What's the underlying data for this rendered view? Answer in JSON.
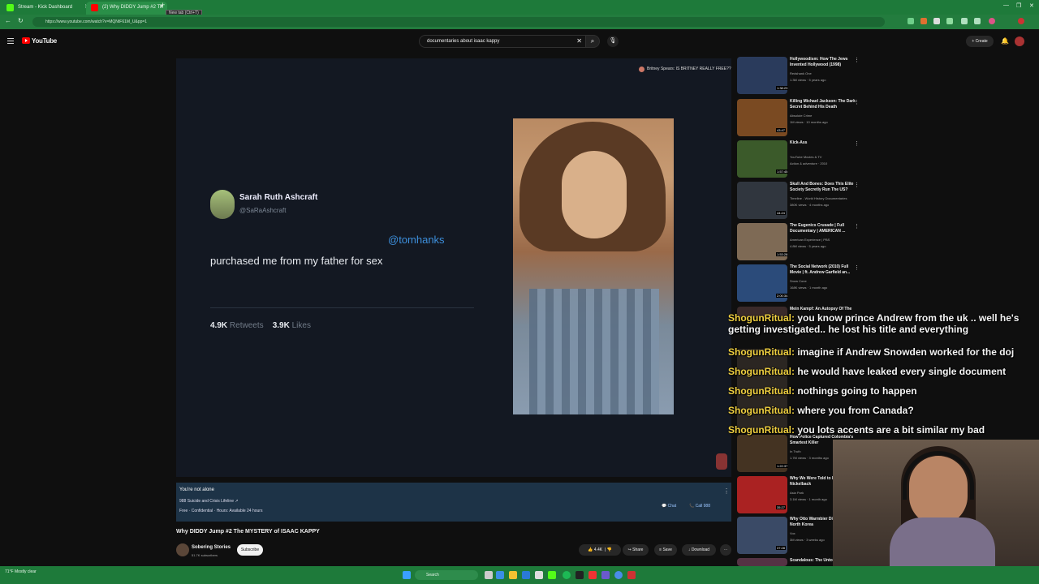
{
  "browser": {
    "tabs": [
      {
        "label": "Stream - Kick Dashboard",
        "favicon_color": "#53fc18"
      },
      {
        "label": "(2) Why DIDDY Jump #2 Th",
        "favicon_color": "#ff0000"
      }
    ],
    "new_tab_tooltip": "New tab (Ctrl+T)",
    "url": "https://www.youtube.com/watch?v=MQNtF61M_U&pp=1"
  },
  "header": {
    "logo_text": "YouTube",
    "search_value": "documentaries about isaac kappy",
    "create_label": "Create"
  },
  "player": {
    "tweet_name": "Sarah Ruth Ashcraft",
    "tweet_handle": "@SaRaAshcraft",
    "tweet_mention": "@tomhanks",
    "tweet_text": "purchased me from my father for sex",
    "retweets_count": "4.9K",
    "retweets_label": "Retweets",
    "likes_count": "3.9K",
    "likes_label": "Likes",
    "endcard_label": "Britney Spears: IS BRITNEY REALLY FREE??"
  },
  "crisis_panel": {
    "title": "You're not alone",
    "line1": "988 Suicide and Crisis Lifeline ↗",
    "line2": "Free · Confidential · Hours: Available 24 hours",
    "chat_label": "Chat",
    "call_label": "Call 988"
  },
  "video": {
    "title": "Why DIDDY Jump #2 The MYSTERY of ISAAC KAPPY",
    "channel": "Sobering Stories",
    "subscribers": "51.7K subscribers",
    "subscribe_label": "Subscribe",
    "like_count": "4.4K",
    "share_label": "Share",
    "save_label": "Save",
    "download_label": "Download"
  },
  "sidebar": [
    {
      "title": "Hollywoodism: How The Jews Invented Hollywood (1998)",
      "channel": "Redshank One",
      "views": "1.3M views · 5 years ago",
      "duration": "1:38:23",
      "color": "#2a3b5c"
    },
    {
      "title": "Killing Michael Jackson: The Dark Secret Behind His Death",
      "channel": "Absolute Crime",
      "views": "1M views · 10 months ago",
      "duration": "43:47",
      "color": "#7a4a22"
    },
    {
      "title": "Kick-Ass",
      "channel": "YouTube Movies & TV",
      "views": "Action & adventure · 2010",
      "duration": "1:57:45",
      "color": "#3b5a2a"
    },
    {
      "title": "Skull And Bones: Does This Elite Society Secretly Run The US?",
      "channel": "Timeline - World History Documentaries",
      "views": "380K views · 4 months ago",
      "duration": "44:24",
      "color": "#30363e"
    },
    {
      "title": "The Eugenics Crusade | Full Documentary | AMERICAN ...",
      "channel": "American Experience | PBS",
      "views": "4.8M views · 5 years ago",
      "duration": "1:53:28",
      "color": "#7e6a55"
    },
    {
      "title": "The Social Network (2010) Full Movie | ft. Andrew Garfield an...",
      "channel": "Snow Cone",
      "views": "168K views · 1 month ago",
      "duration": "2:00:34",
      "color": "#2b4b7a"
    },
    {
      "title": "Mein Kampf: An Autopsy Of The",
      "channel": "",
      "views": "",
      "duration": "",
      "color": "#3a2a2a"
    },
    {
      "title": "How Police Captured Colombia's Smartest Killer",
      "channel": "In Truth",
      "views": "1.7M views · 3 months ago",
      "duration": "1:22:37",
      "color": "#443322"
    },
    {
      "title": "Why We Were Told to H... Nickelback",
      "channel": "Asia Park",
      "views": "3.1M views · 1 month ago",
      "duration": "35:27",
      "color": "#aa2222"
    },
    {
      "title": "Why Otto Warmbier Did... Survive North Korea",
      "channel": "Vox",
      "views": "3M views · 3 weeks ago",
      "duration": "37:28",
      "color": "#3a4a66"
    },
    {
      "title": "Scandalous: The Untold",
      "channel": "",
      "views": "",
      "duration": "",
      "color": "#553344"
    }
  ],
  "chat_messages": [
    {
      "user": "ShogunRitual:",
      "text": " you know prince Andrew from the uk .. well he's getting investigated.. he lost his title and everything"
    },
    {
      "user": "ShogunRitual:",
      "text": " imagine if Andrew Snowden worked for the doj"
    },
    {
      "user": "ShogunRitual:",
      "text": " he would have leaked every single document"
    },
    {
      "user": "ShogunRitual:",
      "text": " nothings going to happen"
    },
    {
      "user": "ShogunRitual:",
      "text": " where you from Canada?"
    },
    {
      "user": "ShogunRitual:",
      "text": " you lots accents are a bit similar my bad"
    }
  ],
  "taskbar": {
    "weather": "71°F Mostly clear",
    "search_placeholder": "Search"
  }
}
